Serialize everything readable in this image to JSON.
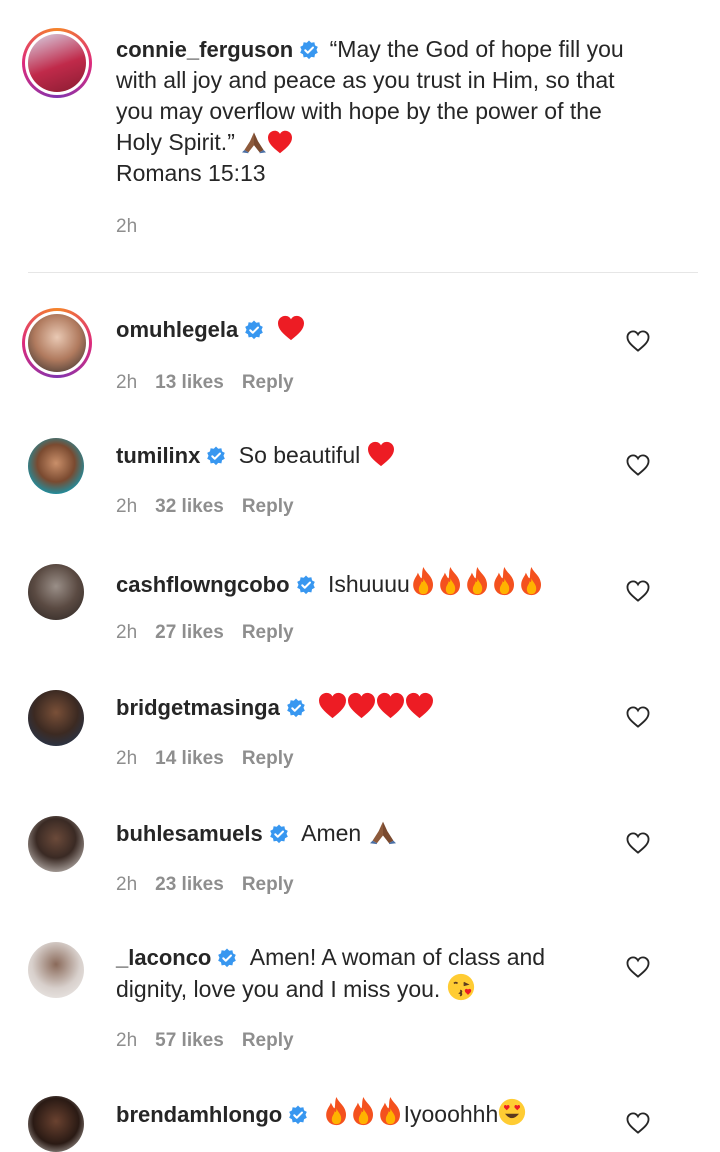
{
  "caption": {
    "username": "connie_ferguson",
    "text_line1": "“May the God of hope fill you",
    "text_line2": "with all joy and peace as you trust in Him, so that",
    "text_line3": "you may overflow with hope by the power of the",
    "text_line4": "Holy Spirit.”",
    "reference": "Romans 15:13",
    "time": "2h"
  },
  "comments": [
    {
      "username": "omuhlegela",
      "text": "",
      "emoji": "heart",
      "time": "2h",
      "likes": "13 likes",
      "reply": "Reply"
    },
    {
      "username": "tumilinx",
      "text": "So beautiful",
      "emoji": "heart",
      "time": "2h",
      "likes": "32 likes",
      "reply": "Reply"
    },
    {
      "username": "cashflowngcobo",
      "text": "Ishuuuu",
      "emoji": "fire-5",
      "time": "2h",
      "likes": "27 likes",
      "reply": "Reply"
    },
    {
      "username": "bridgetmasinga",
      "text": "",
      "emoji": "heart-4",
      "time": "2h",
      "likes": "14 likes",
      "reply": "Reply"
    },
    {
      "username": "buhlesamuels",
      "text": "Amen",
      "emoji": "pray",
      "time": "2h",
      "likes": "23 likes",
      "reply": "Reply"
    },
    {
      "username": "_laconco",
      "text": "Amen! A woman of class and",
      "text2": "dignity, love you and I miss you.",
      "emoji": "kiss",
      "time": "2h",
      "likes": "57 likes",
      "reply": "Reply"
    },
    {
      "username": "brendamhlongo",
      "text": "Iyooohhh",
      "emoji": "fire-3-heart-eyes",
      "time": "",
      "likes": "",
      "reply": ""
    }
  ],
  "colors": {
    "verified": "#3897f0",
    "heart": "#ed4956",
    "meta": "#8e8e8e",
    "text": "#262626"
  }
}
